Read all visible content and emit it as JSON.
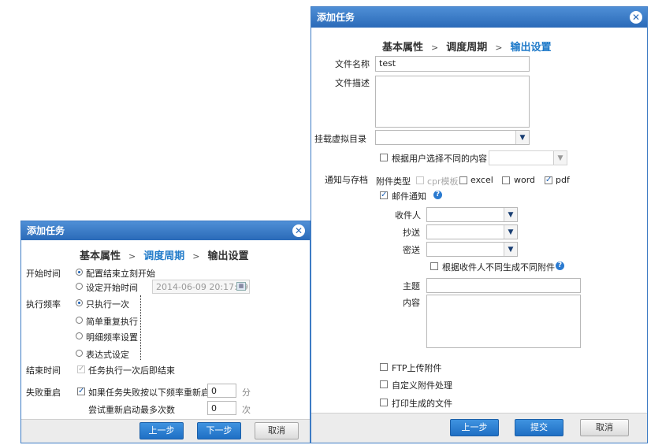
{
  "left_dialog": {
    "title": "添加任务",
    "close_icon": "close-icon",
    "steps": [
      "基本属性",
      "调度周期",
      "输出设置"
    ],
    "active_step": "调度周期",
    "step_separator": ">",
    "start_time": {
      "label": "开始时间",
      "options": [
        "配置结束立刻开始",
        "设定开始时间"
      ],
      "selected": "配置结束立刻开始",
      "datetime_value": "2014-06-09 20:17:39"
    },
    "frequency": {
      "label": "执行频率",
      "options": [
        "只执行一次",
        "简单重复执行",
        "明细频率设置",
        "表达式设定"
      ],
      "selected": "只执行一次"
    },
    "end_time": {
      "label": "结束时间",
      "option": "任务执行一次后即结束",
      "checked": true
    },
    "retry": {
      "label": "失败重启",
      "option": "如果任务失败按以下频率重新启动",
      "checked": true,
      "interval_value": "0",
      "interval_unit": "分",
      "max_label": "尝试重新启动最多次数",
      "max_value": "0",
      "max_unit": "次"
    },
    "buttons": {
      "prev": "上一步",
      "next": "下一步",
      "cancel": "取消"
    }
  },
  "right_dialog": {
    "title": "添加任务",
    "close_icon": "close-icon",
    "steps": [
      "基本属性",
      "调度周期",
      "输出设置"
    ],
    "active_step": "输出设置",
    "step_separator": ">",
    "file_name": {
      "label": "文件名称",
      "value": "test"
    },
    "file_desc": {
      "label": "文件描述",
      "value": ""
    },
    "mount_dir": {
      "label": "挂载虚拟目录",
      "value": ""
    },
    "user_diff": {
      "label": "根据用户选择不同的内容",
      "checked": false
    },
    "notify": {
      "label": "通知与存档",
      "attach_type_label": "附件类型",
      "attach_types": [
        {
          "label": "cpr模板",
          "checked": false,
          "disabled": true
        },
        {
          "label": "excel",
          "checked": false,
          "disabled": false
        },
        {
          "label": "word",
          "checked": false,
          "disabled": false
        },
        {
          "label": "pdf",
          "checked": true,
          "disabled": false
        }
      ]
    },
    "mail": {
      "label": "邮件通知",
      "checked": true,
      "recipient_label": "收件人",
      "cc_label": "抄送",
      "bcc_label": "密送",
      "diff_attach_label": "根据收件人不同生成不同附件",
      "diff_attach_checked": false,
      "subject_label": "主题",
      "subject_value": "",
      "content_label": "内容",
      "content_value": ""
    },
    "ftp": {
      "label": "FTP上传附件",
      "checked": false
    },
    "custom": {
      "label": "自定义附件处理",
      "checked": false
    },
    "print": {
      "label": "打印生成的文件",
      "checked": false
    },
    "buttons": {
      "prev": "上一步",
      "submit": "提交",
      "cancel": "取消"
    }
  },
  "colors": {
    "title_bar": "#2a6ab8",
    "active_step": "#1f7ac9",
    "primary_button": "#1f6fc4"
  }
}
